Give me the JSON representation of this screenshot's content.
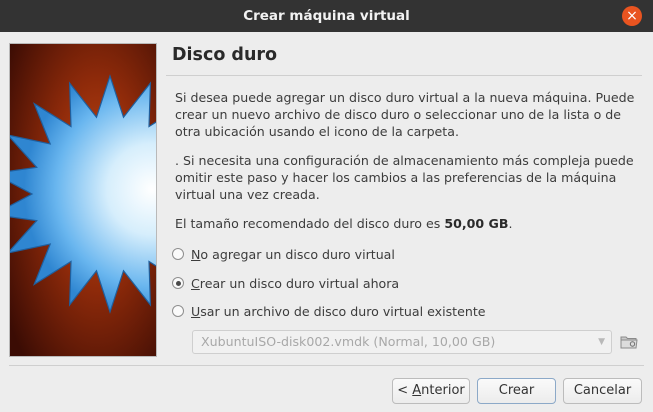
{
  "window": {
    "title": "Crear máquina virtual",
    "close_glyph": "×"
  },
  "page": {
    "heading": "Disco duro",
    "paragraph1": "Si desea puede agregar un disco duro virtual a la nueva máquina. Puede crear un nuevo archivo de disco duro o seleccionar uno de la lista o de otra ubicación usando el icono de la carpeta.",
    "paragraph2": ". Si necesita una configuración de almacenamiento más compleja puede omitir este paso y hacer los cambios a las preferencias de la máquina virtual una vez creada.",
    "recommended_prefix": "El tamaño recomendado del disco duro es ",
    "recommended_size": "50,00 GB",
    "recommended_suffix": "."
  },
  "options": [
    {
      "mnemonic": "N",
      "rest": "o agregar un disco duro virtual",
      "checked": false
    },
    {
      "mnemonic": "C",
      "rest": "rear un disco duro virtual ahora",
      "checked": true
    },
    {
      "mnemonic": "U",
      "rest": "sar un archivo de disco duro virtual existente",
      "checked": false
    }
  ],
  "disk_select": {
    "value": "XubuntuISO-disk002.vmdk (Normal, 10,00 GB)",
    "enabled": false
  },
  "buttons": {
    "back_prefix": "< ",
    "back_mnemonic": "A",
    "back_rest": "nterior",
    "create": "Crear",
    "cancel": "Cancelar"
  },
  "colors": {
    "titlebar": "#333333",
    "close": "#e95420",
    "background": "#ededed"
  }
}
